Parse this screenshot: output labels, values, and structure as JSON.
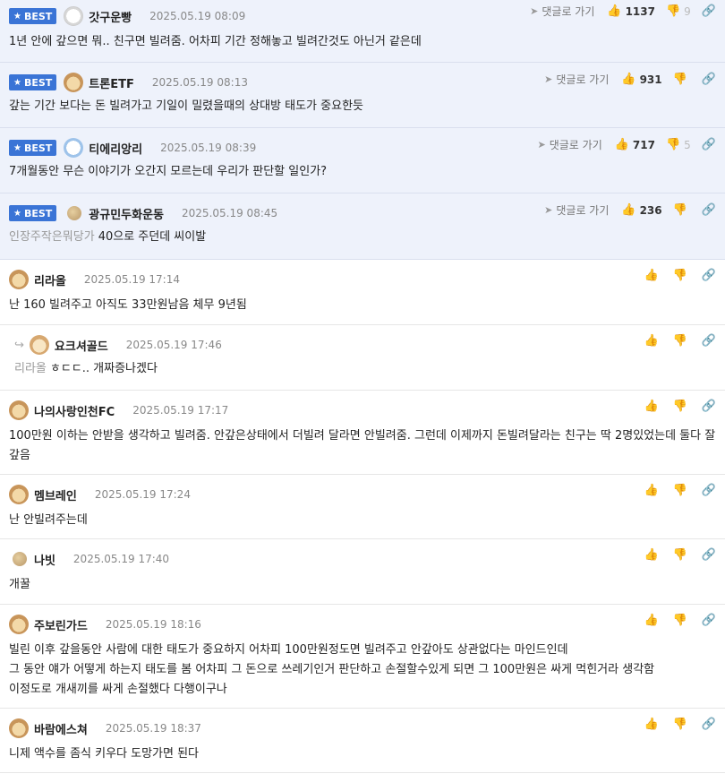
{
  "ui": {
    "best_label": "BEST",
    "reply_label": "댓글로 가기"
  },
  "best_comments": [
    {
      "nick": "갓구운빵",
      "date": "2025.05.19 08:09",
      "up": "1137",
      "down": "9",
      "text": "1년 안에 갚으면 뭐.. 친구면 빌려줌. 어차피 기간 정해놓고 빌려간것도 아닌거 같은데"
    },
    {
      "nick": "트론ETF",
      "date": "2025.05.19 08:13",
      "up": "931",
      "down": "",
      "text": "갚는 기간 보다는 돈 빌려가고 기일이 밀렸을때의 상대방 태도가 중요한듯"
    },
    {
      "nick": "티에리앙리",
      "date": "2025.05.19 08:39",
      "up": "717",
      "down": "5",
      "text": "7개월동안 무슨 이야기가 오간지 모르는데 우리가 판단할 일인가?"
    },
    {
      "nick": "광규민두화운동",
      "date": "2025.05.19 08:45",
      "up": "236",
      "down": "",
      "quote": "인장주작은뭐당가",
      "text": "40으로 주던데 씨이발"
    }
  ],
  "comments": [
    {
      "nick": "리라올",
      "date": "2025.05.19 17:14",
      "text": "난 160 빌려주고 아직도 33만원남음 체무 9년됨"
    },
    {
      "nick": "요크셔골드",
      "date": "2025.05.19 17:46",
      "quote": "리라올",
      "text": "ㅎㄷㄷ.. 개짜증나겠다"
    },
    {
      "nick": "나의사랑인천FC",
      "date": "2025.05.19 17:17",
      "text": "100만원 이하는 안받을 생각하고 빌려줌. 안갚은상태에서 더빌려 달라면 안빌려줌. 그런데 이제까지 돈빌려달라는 친구는 딱 2명있었는데 둘다 잘 갚음"
    },
    {
      "nick": "멤브레인",
      "date": "2025.05.19 17:24",
      "text": "난 안빌려주는데"
    },
    {
      "nick": "나빗",
      "date": "2025.05.19 17:40",
      "text": "개꿀"
    },
    {
      "nick": "주보린가드",
      "date": "2025.05.19 18:16",
      "lines": [
        "빌린 이후 갚을동안 사람에 대한 태도가 중요하지 어차피 100만원정도면 빌려주고 안갚아도 상관없다는 마인드인데",
        "그 동안 얘가 어떻게 하는지 태도를 봄 어차피 그 돈으로 쓰레기인거 판단하고 손절할수있게 되면 그 100만원은 싸게 먹힌거라 생각함",
        "이정도로 개새끼를 싸게 손절했다 다행이구나"
      ]
    },
    {
      "nick": "바람에스쳐",
      "date": "2025.05.19 18:37",
      "text": "니제 액수를 좀식 키우다 도망가면 된다"
    }
  ],
  "icons": {
    "thumbs_up": "thumbs-up-icon",
    "thumbs_down": "thumbs-down-icon",
    "link": "link-icon",
    "reply": "reply-arrow-icon"
  }
}
